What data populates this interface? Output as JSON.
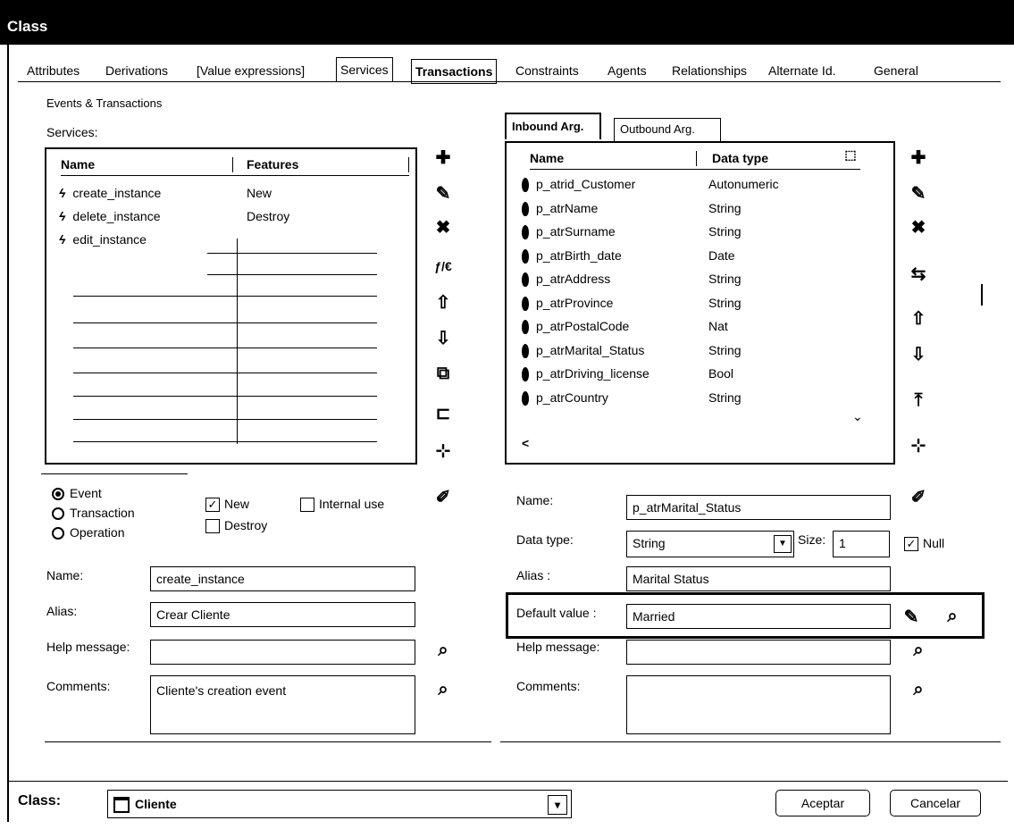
{
  "window": {
    "title": "Class"
  },
  "tabs": [
    {
      "label": "Attributes",
      "state": "normal"
    },
    {
      "label": "Derivations",
      "state": "normal"
    },
    {
      "label": "[Value expressions]",
      "state": "normal"
    },
    {
      "label": "Services",
      "state": "active"
    },
    {
      "label": "Transactions",
      "state": "bold"
    },
    {
      "label": "Constraints",
      "state": "normal"
    },
    {
      "label": "Agents",
      "state": "normal"
    },
    {
      "label": "Relationships",
      "state": "normal"
    },
    {
      "label": "Alternate Id.",
      "state": "normal"
    },
    {
      "label": "General",
      "state": "normal"
    }
  ],
  "left": {
    "group_title": "Events & Transactions",
    "services_label": "Services:",
    "columns": [
      "Name",
      "Features"
    ],
    "services": [
      {
        "name": "create_instance",
        "features": "New"
      },
      {
        "name": "delete_instance",
        "features": "Destroy"
      },
      {
        "name": "edit_instance",
        "features": ""
      }
    ],
    "service_type": {
      "options": [
        "Event",
        "Transaction",
        "Operation"
      ],
      "selected": "Event"
    },
    "checkboxes": {
      "new": {
        "label": "New",
        "checked": true
      },
      "destroy": {
        "label": "Destroy",
        "checked": false
      },
      "internal_use": {
        "label": "Internal use",
        "checked": false
      }
    },
    "form": {
      "name_label": "Name:",
      "name_value": "create_instance",
      "alias_label": "Alias:",
      "alias_value": "Crear Cliente",
      "help_label": "Help message:",
      "help_value": "",
      "comments_label": "Comments:",
      "comments_value": "Cliente's creation event"
    }
  },
  "right": {
    "tabs": [
      "Inbound Arg.",
      "Outbound Arg."
    ],
    "columns": [
      "Name",
      "Data type"
    ],
    "arguments": [
      {
        "name": "p_atrid_Customer",
        "type": "Autonumeric"
      },
      {
        "name": "p_atrName",
        "type": "String"
      },
      {
        "name": "p_atrSurname",
        "type": "String"
      },
      {
        "name": "p_atrBirth_date",
        "type": "Date"
      },
      {
        "name": "p_atrAddress",
        "type": "String"
      },
      {
        "name": "p_atrProvince",
        "type": "String"
      },
      {
        "name": "p_atrPostalCode",
        "type": "Nat"
      },
      {
        "name": "p_atrMarital_Status",
        "type": "String"
      },
      {
        "name": "p_atrDriving_license",
        "type": "Bool"
      },
      {
        "name": "p_atrCountry",
        "type": "String"
      }
    ],
    "form": {
      "name_label": "Name:",
      "name_value": "p_atrMarital_Status",
      "datatype_label": "Data type:",
      "datatype_value": "String",
      "size_label": "Size:",
      "size_value": "1",
      "null_label": "Null",
      "null_checked": true,
      "alias_label": "Alias :",
      "alias_value": "Marital Status",
      "default_label": "Default value :",
      "default_value": "Married",
      "help_label": "Help message:",
      "help_value": "",
      "comments_label": "Comments:",
      "comments_value": ""
    }
  },
  "footer": {
    "class_label": "Class:",
    "class_value": "Cliente",
    "ok_label": "Aceptar",
    "cancel_label": "Cancelar"
  }
}
